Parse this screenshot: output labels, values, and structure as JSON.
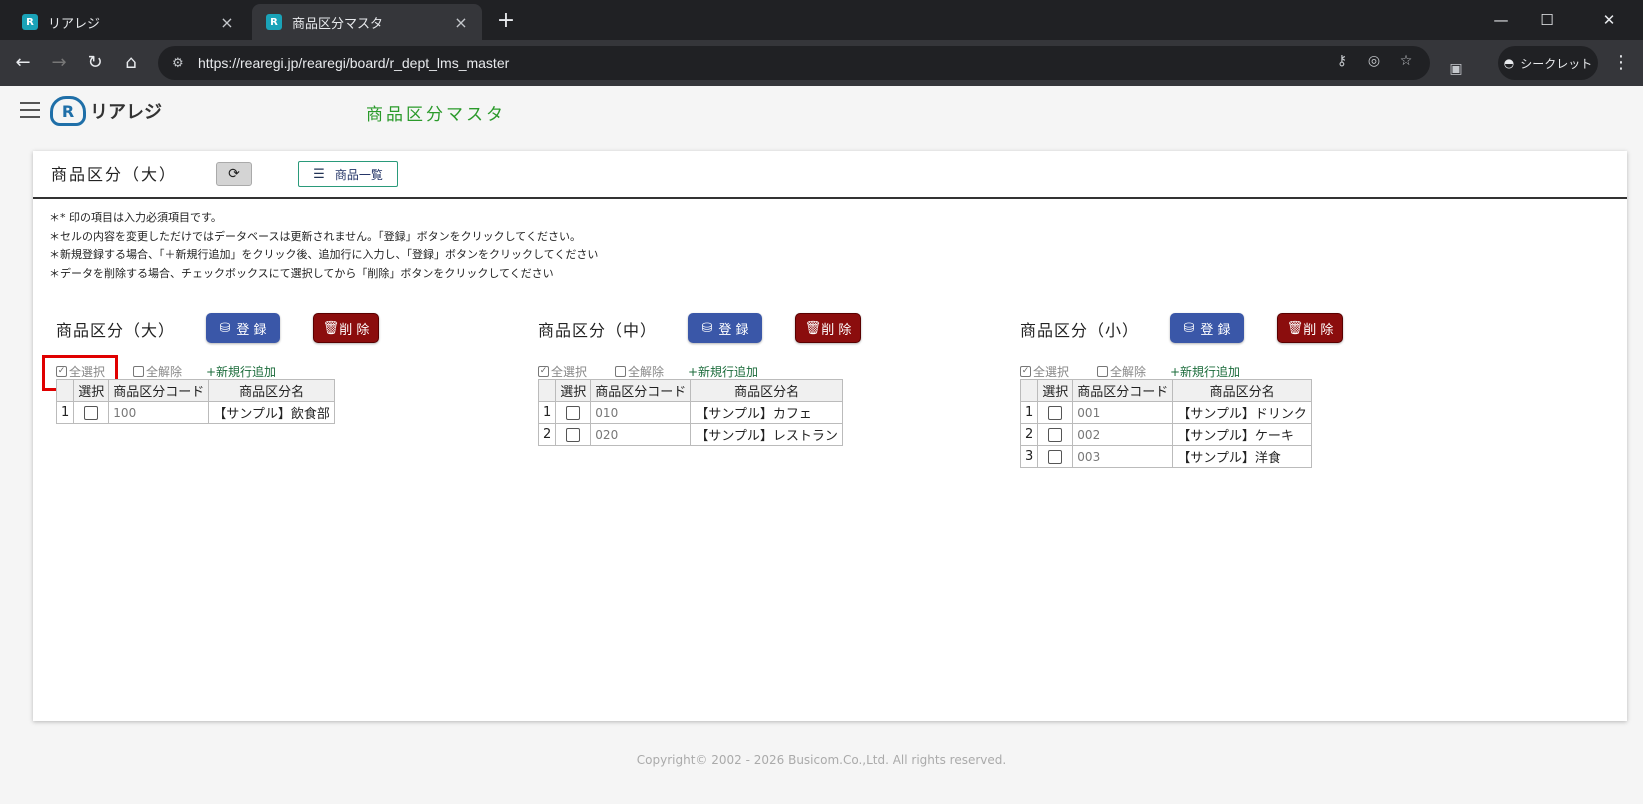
{
  "browser": {
    "tabs": [
      {
        "title": "リアレジ",
        "close": "×"
      },
      {
        "title": "商品区分マスタ",
        "close": "×"
      }
    ],
    "new_tab": "+",
    "url": "https://rearegi.jp/rearegi/board/r_dept_lms_master",
    "incognito_label": "シークレット"
  },
  "app": {
    "logo_text": "リアレジ",
    "page_title": "商品区分マスタ"
  },
  "card": {
    "title": "商品区分（大）",
    "product_list_label": "商品一覧",
    "notes": [
      "＊* 印の項目は入力必須項目です。",
      "＊セルの内容を変更しただけではデータベースは更新されません。「登録」ボタンをクリックしてください。",
      "＊新規登録する場合、「＋新規行追加」をクリック後、追加行に入力し、「登録」ボタンをクリックしてください",
      "＊データを削除する場合、チェックボックスにて選択してから「削除」ボタンをクリックしてください"
    ]
  },
  "sections": [
    {
      "title": "商品区分（大）",
      "register": "登 録",
      "delete": "削 除",
      "select_all": "全選択",
      "deselect_all": "全解除",
      "add_row": "+新規行追加",
      "headers": [
        "",
        "選択",
        "商品区分コード",
        "商品区分名"
      ],
      "rows": [
        {
          "no": "1",
          "code": "100",
          "name": "【サンプル】飲食部"
        }
      ]
    },
    {
      "title": "商品区分（中）",
      "register": "登 録",
      "delete": "削 除",
      "select_all": "全選択",
      "deselect_all": "全解除",
      "add_row": "+新規行追加",
      "headers": [
        "",
        "選択",
        "商品区分コード",
        "商品区分名"
      ],
      "rows": [
        {
          "no": "1",
          "code": "010",
          "name": "【サンプル】カフェ"
        },
        {
          "no": "2",
          "code": "020",
          "name": "【サンプル】レストラン"
        }
      ]
    },
    {
      "title": "商品区分（小）",
      "register": "登 録",
      "delete": "削 除",
      "select_all": "全選択",
      "deselect_all": "全解除",
      "add_row": "+新規行追加",
      "headers": [
        "",
        "選択",
        "商品区分コード",
        "商品区分名"
      ],
      "rows": [
        {
          "no": "1",
          "code": "001",
          "name": "【サンプル】ドリンク"
        },
        {
          "no": "2",
          "code": "002",
          "name": "【サンプル】ケーキ"
        },
        {
          "no": "3",
          "code": "003",
          "name": "【サンプル】洋食"
        }
      ]
    }
  ],
  "footer": "Copyright© 2002 - 2026  Busicom.Co.,Ltd. All rights reserved.",
  "colors": {
    "register": "#3a57a8",
    "delete": "#8b0d0d",
    "title_green": "#2a9a2a",
    "highlight": "#e00000"
  }
}
